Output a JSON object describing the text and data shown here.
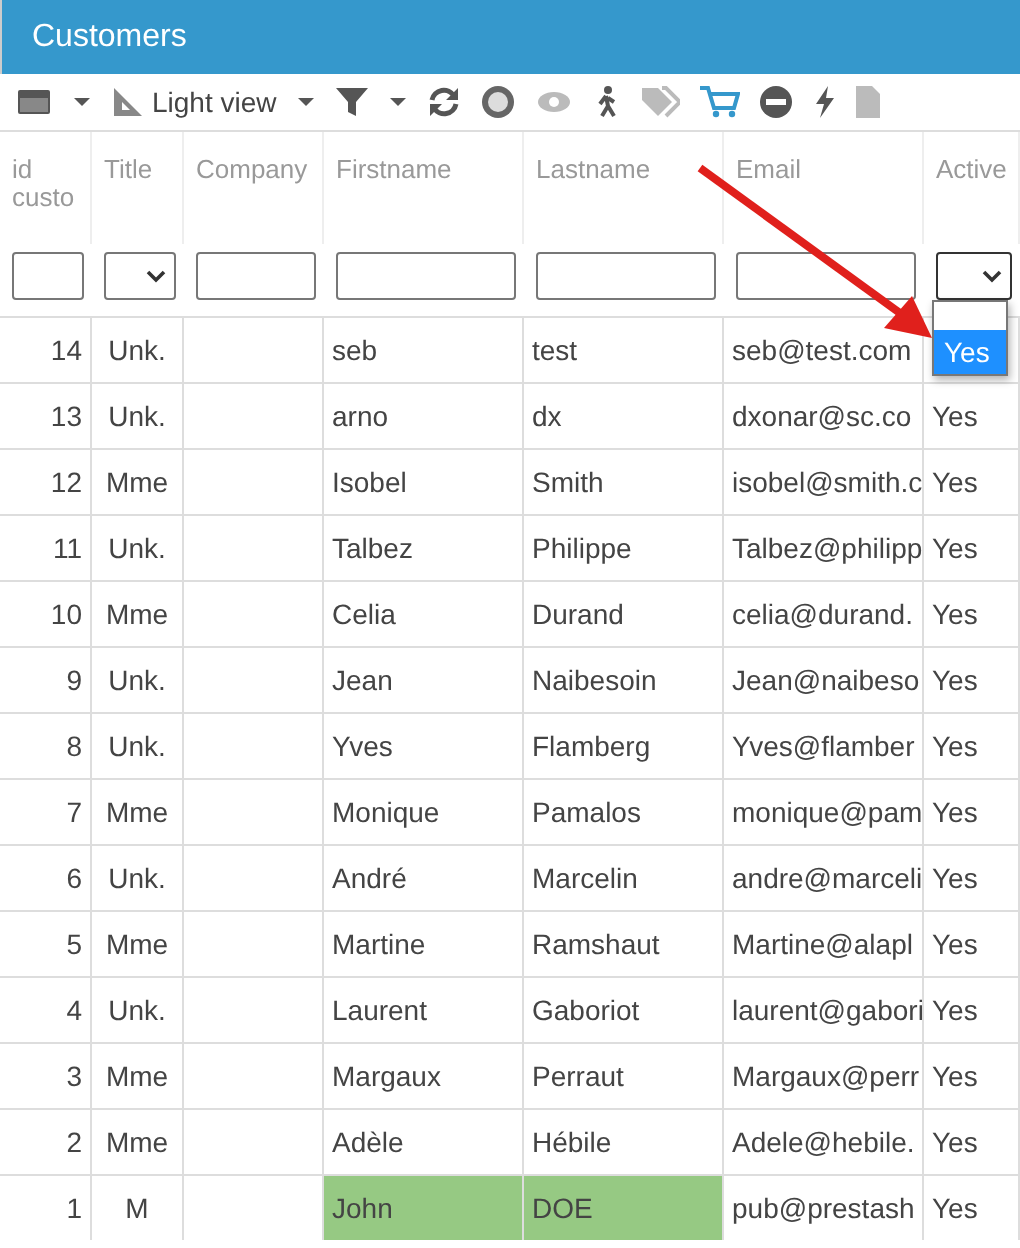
{
  "panel": {
    "title": "Customers"
  },
  "toolbar": {
    "view_label": "Light view"
  },
  "table": {
    "columns": [
      {
        "label": "id custo",
        "filter": {
          "kind": "text"
        }
      },
      {
        "label": "Title",
        "filter": {
          "kind": "select",
          "expanded": false
        }
      },
      {
        "label": "Company",
        "filter": {
          "kind": "text"
        }
      },
      {
        "label": "Firstname",
        "filter": {
          "kind": "text"
        }
      },
      {
        "label": "Lastname",
        "filter": {
          "kind": "text"
        }
      },
      {
        "label": "Email",
        "filter": {
          "kind": "text"
        }
      },
      {
        "label": "Active",
        "filter": {
          "kind": "select",
          "expanded": true,
          "options": [
            {
              "kind": "blank",
              "selected": false
            },
            {
              "kind": "value",
              "label": "Yes",
              "selected": true
            }
          ]
        }
      }
    ],
    "rows": [
      {
        "cells": [
          "14",
          "Unk.",
          "",
          "seb",
          "test",
          "seb@test.com"
        ],
        "highlighted": false
      },
      {
        "cells": [
          "13",
          "Unk.",
          "",
          "arno",
          "dx",
          "dxonar@sc.co",
          "Yes"
        ],
        "highlighted": false
      },
      {
        "cells": [
          "12",
          "Mme",
          "",
          "Isobel",
          "Smith",
          "isobel@smith.c",
          "Yes"
        ],
        "highlighted": false
      },
      {
        "cells": [
          "11",
          "Unk.",
          "",
          "Talbez",
          "Philippe",
          "Talbez@philipp",
          "Yes"
        ],
        "highlighted": false
      },
      {
        "cells": [
          "10",
          "Mme",
          "",
          "Celia",
          "Durand",
          "celia@durand.",
          "Yes"
        ],
        "highlighted": false
      },
      {
        "cells": [
          "9",
          "Unk.",
          "",
          "Jean",
          "Naibesoin",
          "Jean@naibeso",
          "Yes"
        ],
        "highlighted": false
      },
      {
        "cells": [
          "8",
          "Unk.",
          "",
          "Yves",
          "Flamberg",
          "Yves@flamber",
          "Yes"
        ],
        "highlighted": false
      },
      {
        "cells": [
          "7",
          "Mme",
          "",
          "Monique",
          "Pamalos",
          "monique@pam",
          "Yes"
        ],
        "highlighted": false
      },
      {
        "cells": [
          "6",
          "Unk.",
          "",
          "André",
          "Marcelin",
          "andre@marceli",
          "Yes"
        ],
        "highlighted": false
      },
      {
        "cells": [
          "5",
          "Mme",
          "",
          "Martine",
          "Ramshaut",
          "Martine@alapl",
          "Yes"
        ],
        "highlighted": false
      },
      {
        "cells": [
          "4",
          "Unk.",
          "",
          "Laurent",
          "Gaboriot",
          "laurent@gabori",
          "Yes"
        ],
        "highlighted": false
      },
      {
        "cells": [
          "3",
          "Mme",
          "",
          "Margaux",
          "Perraut",
          "Margaux@perr",
          "Yes"
        ],
        "highlighted": false
      },
      {
        "cells": [
          "2",
          "Mme",
          "",
          "Adèle",
          "Hébile",
          "Adele@hebile.",
          "Yes"
        ],
        "highlighted": false
      },
      {
        "cells": [
          "1",
          "M",
          "",
          "John",
          "DOE",
          "pub@prestash",
          "Yes"
        ],
        "highlighted": true
      }
    ]
  }
}
